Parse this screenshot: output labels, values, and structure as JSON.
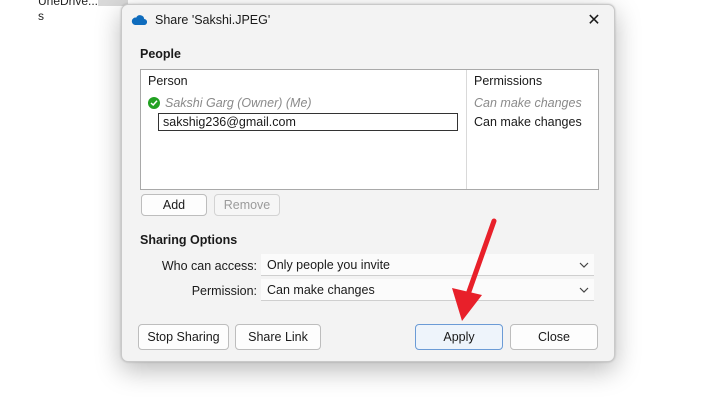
{
  "background": {
    "explorer_text_1": "UneDrive...",
    "explorer_text_2": "s"
  },
  "dialog": {
    "title": "Share 'Sakshi.JPEG'",
    "close_glyph": "✕"
  },
  "people": {
    "section_label": "People",
    "columns": [
      "Person",
      "Permissions"
    ],
    "owner": {
      "name": "Sakshi Garg (Owner) (Me)",
      "permission": "Can make changes"
    },
    "invitee": {
      "email": "sakshig236@gmail.com",
      "permission": "Can make changes"
    },
    "add_label": "Add",
    "remove_label": "Remove"
  },
  "sharing_options": {
    "section_label": "Sharing Options",
    "who_label": "Who can access:",
    "who_value": "Only people you invite",
    "permission_label": "Permission:",
    "permission_value": "Can make changes"
  },
  "footer": {
    "stop_sharing_label": "Stop Sharing",
    "share_link_label": "Share Link",
    "apply_label": "Apply",
    "close_label": "Close"
  },
  "colors": {
    "accent_blue": "#0078d4",
    "owner_check_green": "#21a121",
    "arrow_red": "#e8202a"
  },
  "icons": {
    "title_icon": "cloud-icon",
    "owner_status_icon": "check-circle-icon",
    "dropdown_icon": "chevron-down-icon",
    "annotation": "red-arrow-icon"
  }
}
